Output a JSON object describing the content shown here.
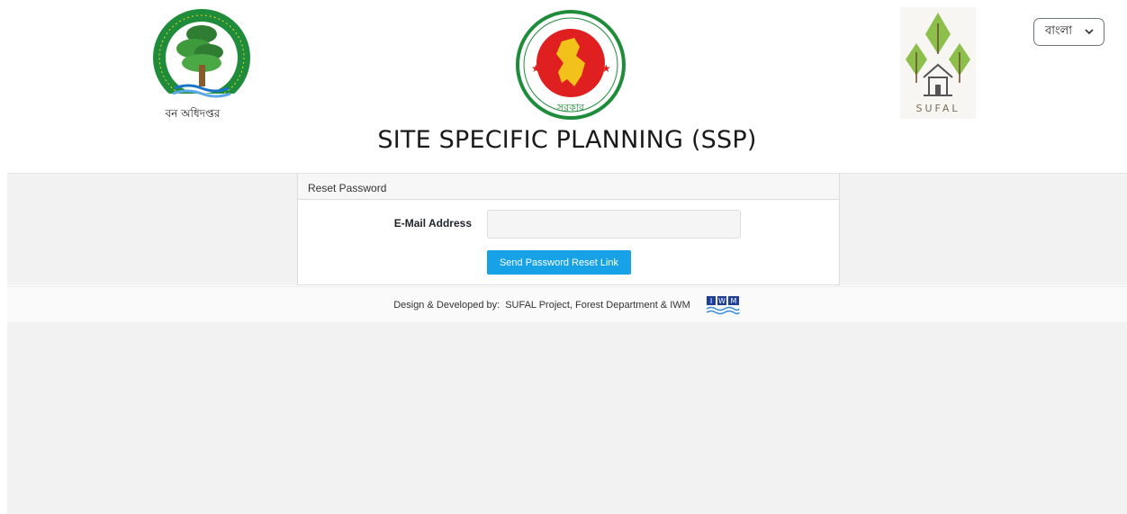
{
  "header": {
    "forest_logo_caption": "বন অধিদপ্তর",
    "gov_seal_text": "গণপ্রজাতন্ত্রী বাংলাদেশ সরকার",
    "sufal_logo_text": "SUFAL",
    "title": "SITE SPECIFIC PLANNING (SSP)",
    "language_select": {
      "selected": "বাংলা"
    }
  },
  "form": {
    "card_title": "Reset Password",
    "email_label": "E-Mail Address",
    "email_value": "",
    "submit_label": "Send Password Reset Link"
  },
  "footer": {
    "prefix": "Design & Developed by:",
    "credit": "SUFAL Project, Forest Department & IWM",
    "iwm_logo_text": "IWM"
  },
  "colors": {
    "button": "#17a2e8",
    "forest_green": "#1e8c3a",
    "seal_red": "#e02020",
    "panel_bg": "#f2f2f2"
  },
  "icons": [
    "forest-department-logo-icon",
    "bangladesh-government-seal-icon",
    "sufal-logo-icon",
    "chevron-down-icon",
    "iwm-logo-icon"
  ]
}
